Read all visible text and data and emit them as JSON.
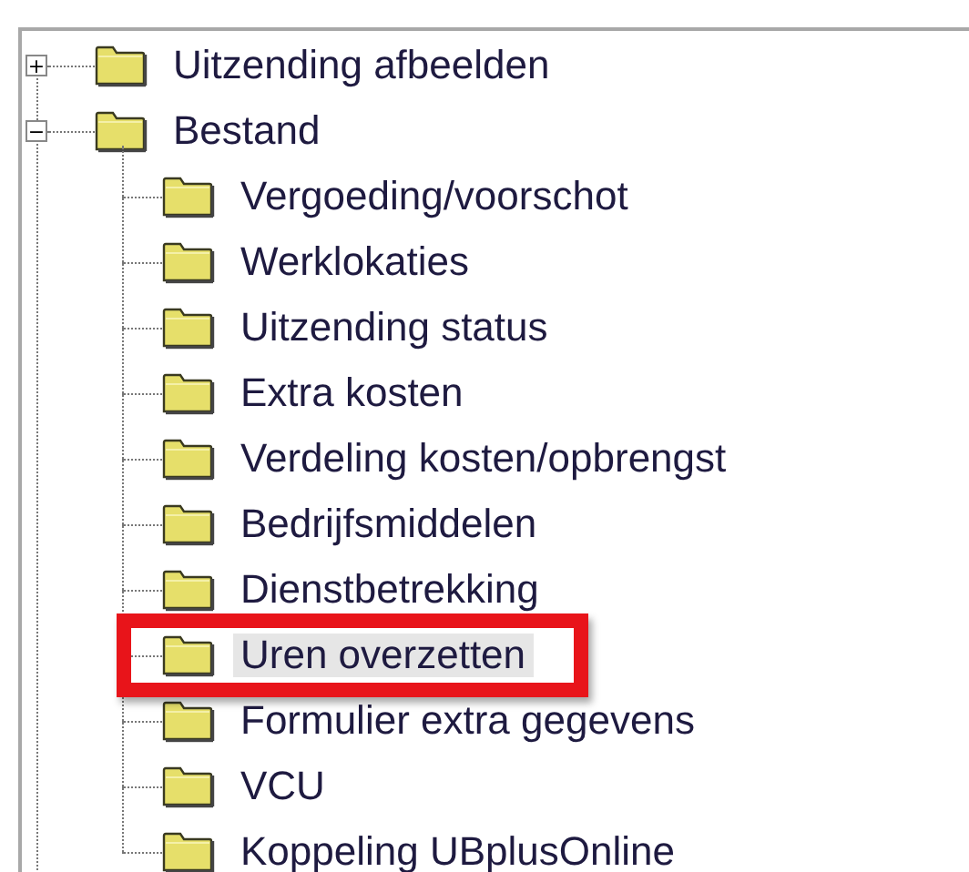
{
  "tree": [
    {
      "label": "Uitzending afbeelden",
      "expander": "+",
      "selected": false
    },
    {
      "label": "Bestand",
      "expander": "−",
      "selected": false,
      "children": [
        {
          "label": "Vergoeding/voorschot",
          "selected": false
        },
        {
          "label": "Werklokaties",
          "selected": false
        },
        {
          "label": "Uitzending status",
          "selected": false
        },
        {
          "label": "Extra kosten",
          "selected": false
        },
        {
          "label": "Verdeling kosten/opbrengst",
          "selected": false
        },
        {
          "label": "Bedrijfsmiddelen",
          "selected": false
        },
        {
          "label": "Dienstbetrekking",
          "selected": false
        },
        {
          "label": "Uren overzetten",
          "selected": true
        },
        {
          "label": "Formulier extra gegevens",
          "selected": false
        },
        {
          "label": "VCU",
          "selected": false
        },
        {
          "label": "Koppeling UBplusOnline",
          "selected": false
        }
      ]
    }
  ],
  "highlight_box": {
    "shown": true
  }
}
